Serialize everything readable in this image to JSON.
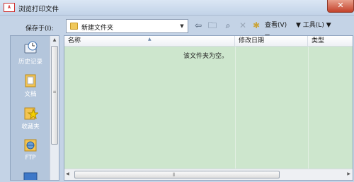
{
  "window": {
    "title": "浏览打印文件",
    "app_icon_text": "A"
  },
  "toolbar": {
    "save_in_label": "保存于(I):",
    "folder_selected": "新建文件夹",
    "views_label": "查看(V)",
    "tools_label": "工具(L)"
  },
  "places": [
    {
      "label": "历史记录",
      "icon": "history-icon"
    },
    {
      "label": "文档",
      "icon": "documents-icon"
    },
    {
      "label": "收藏夹",
      "icon": "favorites-icon"
    },
    {
      "label": "FTP",
      "icon": "ftp-icon"
    },
    {
      "label": "",
      "icon": "desktop-icon"
    }
  ],
  "file_list": {
    "columns": [
      "名称",
      "修改日期",
      "类型"
    ],
    "empty_message": "该文件夹为空。",
    "rows": []
  },
  "colors": {
    "list_background": "#cde6cd",
    "places_background": "#b4c6dc",
    "close_button": "#c3412a"
  }
}
